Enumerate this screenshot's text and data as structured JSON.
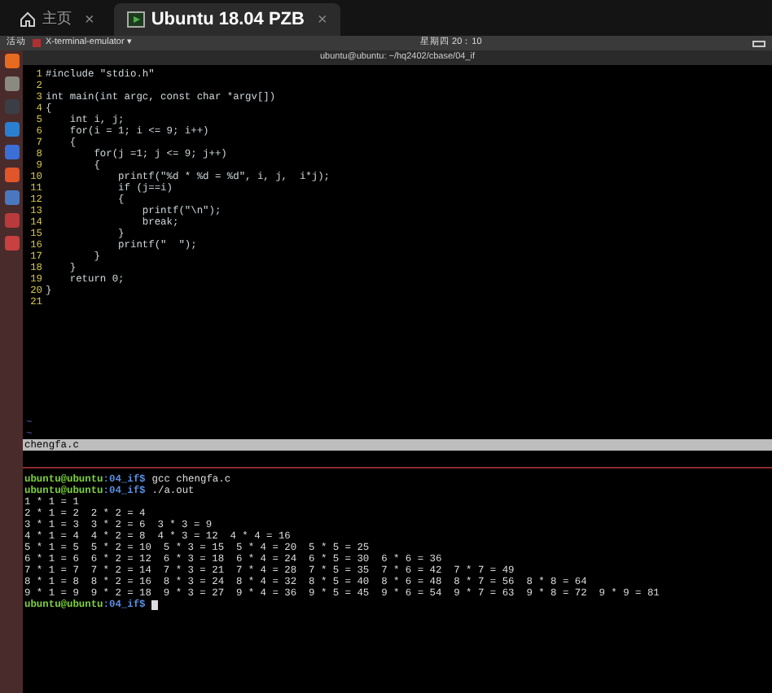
{
  "browser_tabs": [
    {
      "label": "主页",
      "selected": false,
      "kind": "home",
      "close": "×"
    },
    {
      "label": "Ubuntu 18.04 PZB",
      "selected": true,
      "kind": "vm",
      "close": "×"
    }
  ],
  "top_panel": {
    "activities": "活动",
    "app_menu": "X-terminal-emulator ▾",
    "clock": "星期四 20：10"
  },
  "terminal_title": "ubuntu@ubuntu: ~/hq2402/cbase/04_if",
  "dock": [
    {
      "color": "#e66a1f"
    },
    {
      "color": "#8a8a80"
    },
    {
      "color": "#3a3f46"
    },
    {
      "color": "#2a7fd0"
    },
    {
      "color": "#3c6fd6"
    },
    {
      "color": "#e0552a"
    },
    {
      "color": "#4a78c0"
    },
    {
      "color": "#b83a3a"
    },
    {
      "color": "#c84040"
    }
  ],
  "editor": {
    "lines": [
      {
        "number": "1",
        "text": "#include \"stdio.h\""
      },
      {
        "number": "2"
      },
      {
        "number": "3",
        "text": "int main(int argc, const char *argv[])"
      },
      {
        "number": "4",
        "text": "{"
      },
      {
        "number": "5",
        "text": "    int i, j;"
      },
      {
        "number": "6",
        "text": "    for(i = 1; i <= 9; i++)"
      },
      {
        "number": "7",
        "text": "    {"
      },
      {
        "number": "8",
        "text": "        for(j =1; j <= 9; j++)"
      },
      {
        "number": "9",
        "text": "        {"
      },
      {
        "number": "10",
        "text": "            printf(\"%d * %d = %d\", i, j,  i*j);"
      },
      {
        "number": "11",
        "text": "            if (j==i)"
      },
      {
        "number": "12",
        "text": "            {"
      },
      {
        "number": "13",
        "text": "                printf(\"\\n\");"
      },
      {
        "number": "14",
        "text": "                break;"
      },
      {
        "number": "15",
        "text": "            }"
      },
      {
        "number": "16",
        "text": "            printf(\"  \");"
      },
      {
        "number": "17",
        "text": "        }"
      },
      {
        "number": "18",
        "text": "    }"
      },
      {
        "number": "19",
        "text": "    return 0;"
      },
      {
        "number": "20",
        "text": "}"
      },
      {
        "number": "21"
      }
    ],
    "tilde_lines": [
      "~",
      "~"
    ],
    "status": "chengfa.c"
  },
  "shell": [
    {
      "kind": "prompt",
      "user": "ubuntu@ubuntu",
      "path": ":04_if$",
      "command": "gcc chengfa.c"
    },
    {
      "kind": "prompt",
      "user": "ubuntu@ubuntu",
      "path": ":04_if$",
      "command": "./a.out"
    },
    {
      "kind": "output",
      "text": "1 * 1 = 1"
    },
    {
      "kind": "output",
      "text": "2 * 1 = 2  2 * 2 = 4"
    },
    {
      "kind": "output",
      "text": "3 * 1 = 3  3 * 2 = 6  3 * 3 = 9"
    },
    {
      "kind": "output",
      "text": "4 * 1 = 4  4 * 2 = 8  4 * 3 = 12  4 * 4 = 16"
    },
    {
      "kind": "output",
      "text": "5 * 1 = 5  5 * 2 = 10  5 * 3 = 15  5 * 4 = 20  5 * 5 = 25"
    },
    {
      "kind": "output",
      "text": "6 * 1 = 6  6 * 2 = 12  6 * 3 = 18  6 * 4 = 24  6 * 5 = 30  6 * 6 = 36"
    },
    {
      "kind": "output",
      "text": "7 * 1 = 7  7 * 2 = 14  7 * 3 = 21  7 * 4 = 28  7 * 5 = 35  7 * 6 = 42  7 * 7 = 49"
    },
    {
      "kind": "output",
      "text": "8 * 1 = 8  8 * 2 = 16  8 * 3 = 24  8 * 4 = 32  8 * 5 = 40  8 * 6 = 48  8 * 7 = 56  8 * 8 = 64"
    },
    {
      "kind": "output",
      "text": "9 * 1 = 9  9 * 2 = 18  9 * 3 = 27  9 * 4 = 36  9 * 5 = 45  9 * 6 = 54  9 * 7 = 63  9 * 8 = 72  9 * 9 = 81"
    },
    {
      "kind": "prompt",
      "user": "ubuntu@ubuntu",
      "path": ":04_if$",
      "cursor": true
    }
  ]
}
